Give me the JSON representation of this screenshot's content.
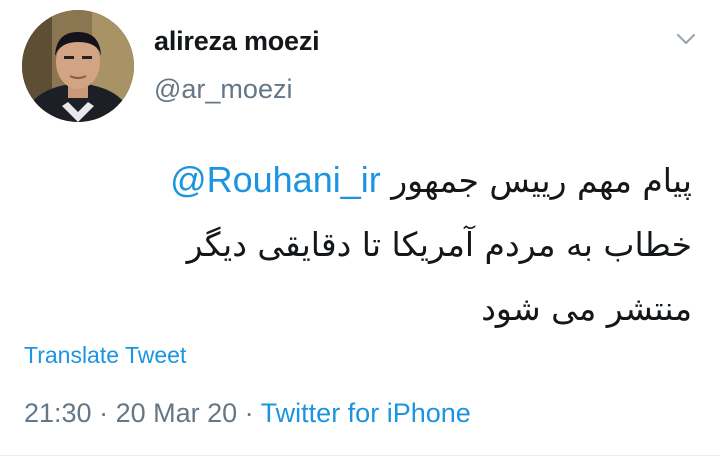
{
  "user": {
    "display_name": "alireza moezi",
    "handle": "@ar_moezi"
  },
  "tweet": {
    "line1_text": "پیام مهم رییس جمهور",
    "line1_mention": "@Rouhani_ir",
    "line2": "خطاب به مردم آمریکا تا دقایقی دیگر",
    "line3": "منتشر می شود"
  },
  "translate_label": "Translate Tweet",
  "meta": {
    "time": "21:30",
    "sep1": " · ",
    "date": "20 Mar 20",
    "sep2": " · ",
    "source": "Twitter for iPhone"
  },
  "colors": {
    "link": "#1b95e0",
    "secondary_text": "#657786",
    "primary_text": "#14171a"
  },
  "icons": {
    "menu": "chevron-down-icon"
  }
}
